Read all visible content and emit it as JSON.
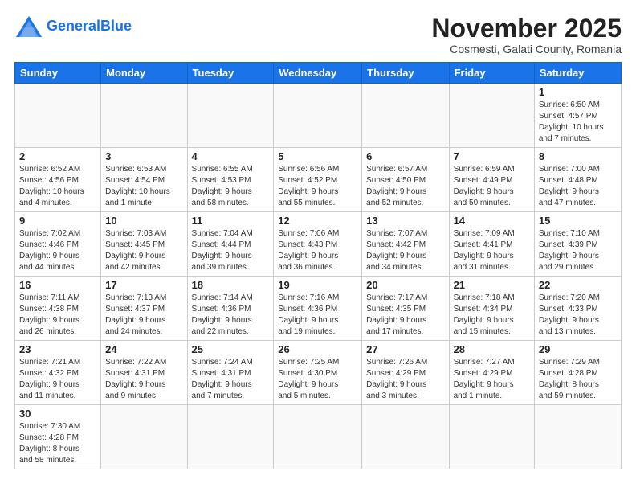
{
  "header": {
    "logo_text_general": "General",
    "logo_text_blue": "Blue",
    "month_title": "November 2025",
    "subtitle": "Cosmesti, Galati County, Romania"
  },
  "weekdays": [
    "Sunday",
    "Monday",
    "Tuesday",
    "Wednesday",
    "Thursday",
    "Friday",
    "Saturday"
  ],
  "weeks": [
    [
      {
        "day": "",
        "info": ""
      },
      {
        "day": "",
        "info": ""
      },
      {
        "day": "",
        "info": ""
      },
      {
        "day": "",
        "info": ""
      },
      {
        "day": "",
        "info": ""
      },
      {
        "day": "",
        "info": ""
      },
      {
        "day": "1",
        "info": "Sunrise: 6:50 AM\nSunset: 4:57 PM\nDaylight: 10 hours\nand 7 minutes."
      }
    ],
    [
      {
        "day": "2",
        "info": "Sunrise: 6:52 AM\nSunset: 4:56 PM\nDaylight: 10 hours\nand 4 minutes."
      },
      {
        "day": "3",
        "info": "Sunrise: 6:53 AM\nSunset: 4:54 PM\nDaylight: 10 hours\nand 1 minute."
      },
      {
        "day": "4",
        "info": "Sunrise: 6:55 AM\nSunset: 4:53 PM\nDaylight: 9 hours\nand 58 minutes."
      },
      {
        "day": "5",
        "info": "Sunrise: 6:56 AM\nSunset: 4:52 PM\nDaylight: 9 hours\nand 55 minutes."
      },
      {
        "day": "6",
        "info": "Sunrise: 6:57 AM\nSunset: 4:50 PM\nDaylight: 9 hours\nand 52 minutes."
      },
      {
        "day": "7",
        "info": "Sunrise: 6:59 AM\nSunset: 4:49 PM\nDaylight: 9 hours\nand 50 minutes."
      },
      {
        "day": "8",
        "info": "Sunrise: 7:00 AM\nSunset: 4:48 PM\nDaylight: 9 hours\nand 47 minutes."
      }
    ],
    [
      {
        "day": "9",
        "info": "Sunrise: 7:02 AM\nSunset: 4:46 PM\nDaylight: 9 hours\nand 44 minutes."
      },
      {
        "day": "10",
        "info": "Sunrise: 7:03 AM\nSunset: 4:45 PM\nDaylight: 9 hours\nand 42 minutes."
      },
      {
        "day": "11",
        "info": "Sunrise: 7:04 AM\nSunset: 4:44 PM\nDaylight: 9 hours\nand 39 minutes."
      },
      {
        "day": "12",
        "info": "Sunrise: 7:06 AM\nSunset: 4:43 PM\nDaylight: 9 hours\nand 36 minutes."
      },
      {
        "day": "13",
        "info": "Sunrise: 7:07 AM\nSunset: 4:42 PM\nDaylight: 9 hours\nand 34 minutes."
      },
      {
        "day": "14",
        "info": "Sunrise: 7:09 AM\nSunset: 4:41 PM\nDaylight: 9 hours\nand 31 minutes."
      },
      {
        "day": "15",
        "info": "Sunrise: 7:10 AM\nSunset: 4:39 PM\nDaylight: 9 hours\nand 29 minutes."
      }
    ],
    [
      {
        "day": "16",
        "info": "Sunrise: 7:11 AM\nSunset: 4:38 PM\nDaylight: 9 hours\nand 26 minutes."
      },
      {
        "day": "17",
        "info": "Sunrise: 7:13 AM\nSunset: 4:37 PM\nDaylight: 9 hours\nand 24 minutes."
      },
      {
        "day": "18",
        "info": "Sunrise: 7:14 AM\nSunset: 4:36 PM\nDaylight: 9 hours\nand 22 minutes."
      },
      {
        "day": "19",
        "info": "Sunrise: 7:16 AM\nSunset: 4:36 PM\nDaylight: 9 hours\nand 19 minutes."
      },
      {
        "day": "20",
        "info": "Sunrise: 7:17 AM\nSunset: 4:35 PM\nDaylight: 9 hours\nand 17 minutes."
      },
      {
        "day": "21",
        "info": "Sunrise: 7:18 AM\nSunset: 4:34 PM\nDaylight: 9 hours\nand 15 minutes."
      },
      {
        "day": "22",
        "info": "Sunrise: 7:20 AM\nSunset: 4:33 PM\nDaylight: 9 hours\nand 13 minutes."
      }
    ],
    [
      {
        "day": "23",
        "info": "Sunrise: 7:21 AM\nSunset: 4:32 PM\nDaylight: 9 hours\nand 11 minutes."
      },
      {
        "day": "24",
        "info": "Sunrise: 7:22 AM\nSunset: 4:31 PM\nDaylight: 9 hours\nand 9 minutes."
      },
      {
        "day": "25",
        "info": "Sunrise: 7:24 AM\nSunset: 4:31 PM\nDaylight: 9 hours\nand 7 minutes."
      },
      {
        "day": "26",
        "info": "Sunrise: 7:25 AM\nSunset: 4:30 PM\nDaylight: 9 hours\nand 5 minutes."
      },
      {
        "day": "27",
        "info": "Sunrise: 7:26 AM\nSunset: 4:29 PM\nDaylight: 9 hours\nand 3 minutes."
      },
      {
        "day": "28",
        "info": "Sunrise: 7:27 AM\nSunset: 4:29 PM\nDaylight: 9 hours\nand 1 minute."
      },
      {
        "day": "29",
        "info": "Sunrise: 7:29 AM\nSunset: 4:28 PM\nDaylight: 8 hours\nand 59 minutes."
      }
    ],
    [
      {
        "day": "30",
        "info": "Sunrise: 7:30 AM\nSunset: 4:28 PM\nDaylight: 8 hours\nand 58 minutes."
      },
      {
        "day": "",
        "info": ""
      },
      {
        "day": "",
        "info": ""
      },
      {
        "day": "",
        "info": ""
      },
      {
        "day": "",
        "info": ""
      },
      {
        "day": "",
        "info": ""
      },
      {
        "day": "",
        "info": ""
      }
    ]
  ]
}
